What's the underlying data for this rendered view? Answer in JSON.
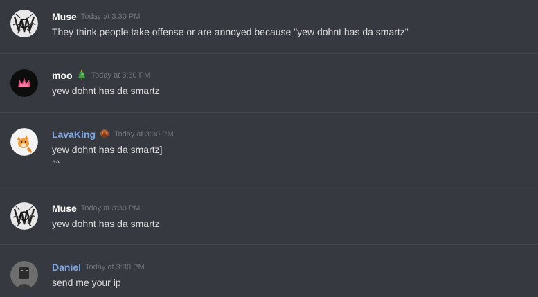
{
  "colors": {
    "background": "#36393f",
    "divider": "#42454b",
    "username_white": "#ffffff",
    "username_blue": "#7fa8e6",
    "timestamp": "#72767d",
    "message_text": "#dcddde"
  },
  "messages": [
    {
      "username": "Muse",
      "timestamp": "Today at 3:30 PM",
      "lines": [
        "They think people take offense or are annoyed because \"yew dohnt has da smartz\""
      ],
      "avatar_icon": "black-white-sketch-avatar"
    },
    {
      "username": "moo",
      "badge_icon": "christmas-tree-icon",
      "timestamp": "Today at 3:30 PM",
      "lines": [
        "yew dohnt has da smartz"
      ],
      "avatar_icon": "pink-crown-avatar"
    },
    {
      "username": "LavaKing",
      "badge_icon": "turkey-icon",
      "timestamp": "Today at 3:30 PM",
      "lines": [
        "yew dohnt has da smartz]",
        "^^"
      ],
      "avatar_icon": "orange-fox-avatar"
    },
    {
      "username": "Muse",
      "timestamp": "Today at 3:30 PM",
      "lines": [
        "yew dohnt has da smartz"
      ],
      "avatar_icon": "black-white-sketch-avatar"
    },
    {
      "username": "Daniel",
      "timestamp": "Today at 3:30 PM",
      "lines": [
        "send me your ip"
      ],
      "avatar_icon": "gray-portrait-avatar"
    }
  ]
}
